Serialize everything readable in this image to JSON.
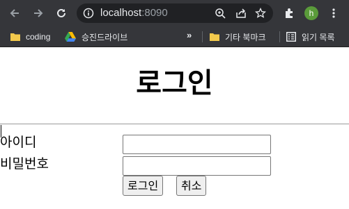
{
  "browser": {
    "url_host": "localhost",
    "url_port": ":8090",
    "avatar_letter": "h",
    "icons": [
      "back-icon",
      "forward-icon",
      "reload-icon",
      "site-info-icon",
      "zoom-icon",
      "share-icon",
      "star-icon",
      "extensions-icon",
      "menu-icon"
    ]
  },
  "bookmarks": {
    "items": [
      {
        "label": "coding",
        "icon": "folder-icon"
      },
      {
        "label": "승진드라이브",
        "icon": "google-drive-icon"
      }
    ],
    "more": "»",
    "right_items": [
      {
        "label": "기타 북마크",
        "icon": "folder-icon"
      },
      {
        "label": "읽기 목록",
        "icon": "reading-list-icon"
      }
    ]
  },
  "page": {
    "title": "로그인",
    "id_label": "아이디",
    "id_value": "",
    "password_label": "비밀번호",
    "password_value": "",
    "login_button": "로그인",
    "cancel_button": "취소"
  },
  "colors": {
    "chrome_bg": "#35363a",
    "omnibox_bg": "#202124",
    "avatar": "#5a9b3a",
    "folder": "#f2c94c"
  }
}
